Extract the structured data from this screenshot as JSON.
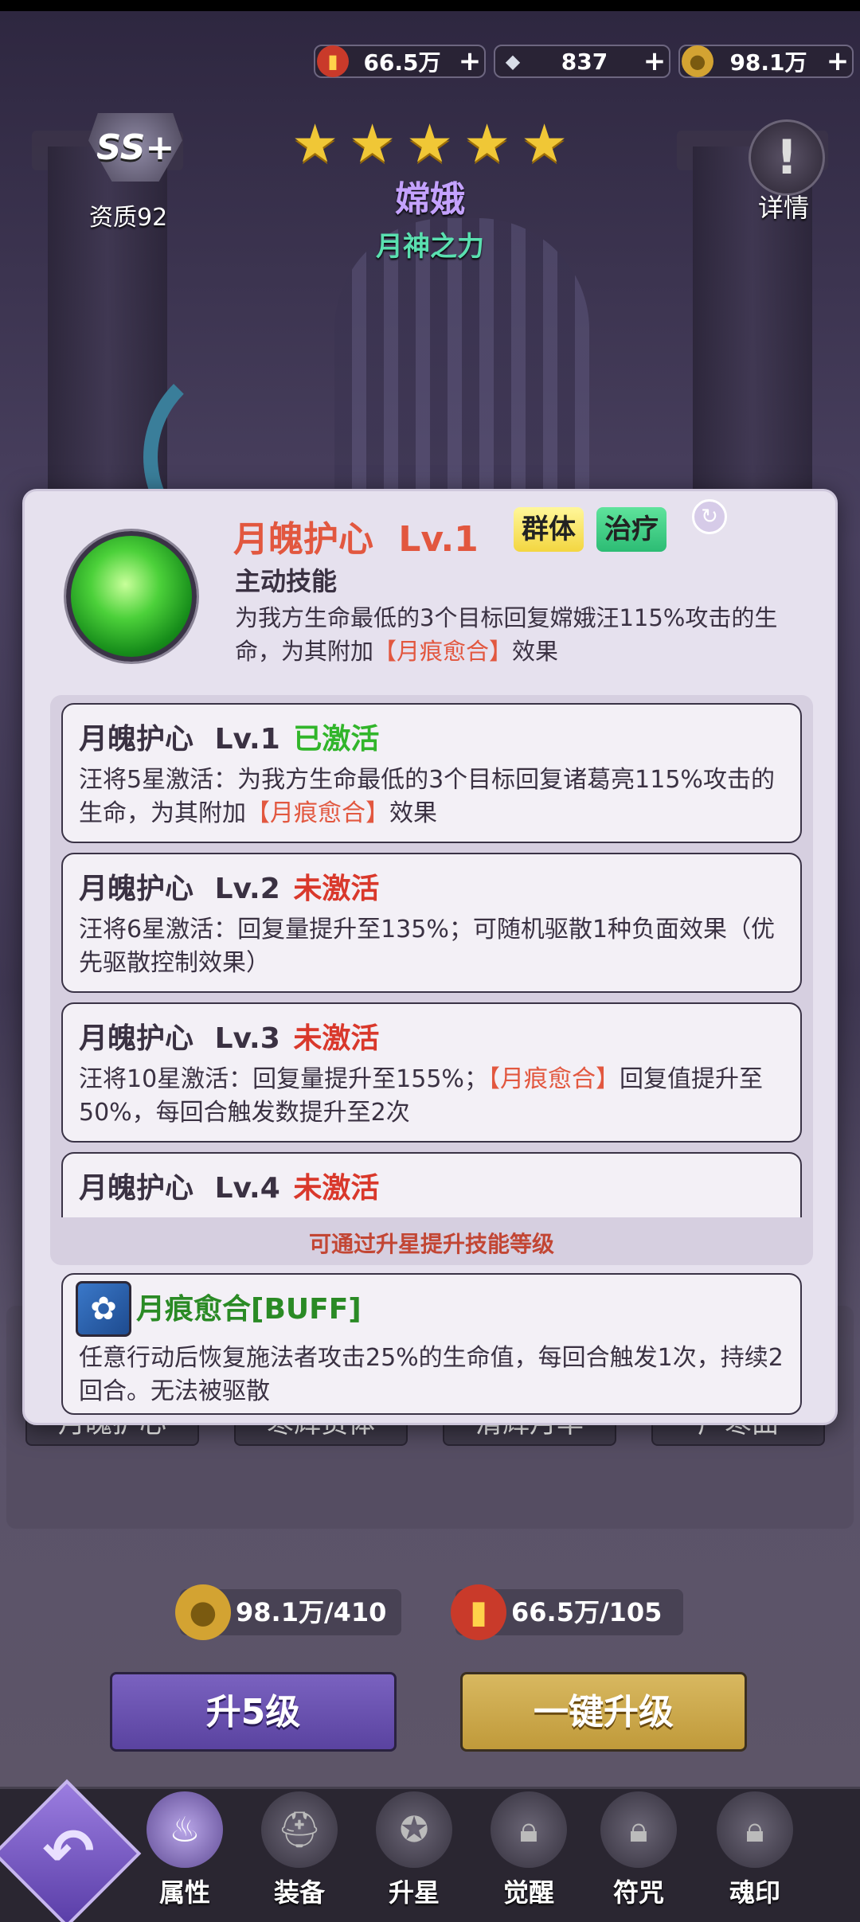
{
  "currency": {
    "fries": {
      "icon": "fries-icon",
      "value": "66.5万"
    },
    "diamond": {
      "icon": "diamond-icon",
      "value": "837"
    },
    "coin": {
      "icon": "coin-icon",
      "value": "98.1万"
    }
  },
  "hero": {
    "rank_badge": "SS+",
    "aptitude": "资质92",
    "stars": 5,
    "name": "嫦娥",
    "title": "月神之力",
    "detail_label": "详情"
  },
  "popup": {
    "skill_name": "月魄护心",
    "skill_level": "Lv.1",
    "tags": [
      "群体",
      "治疗"
    ],
    "skill_type": "主动技能",
    "description_prefix": "为我方生命最低的3个目标回复嫦娥汪115%攻击的生命，为其附加",
    "description_highlight": "【月痕愈合】",
    "description_suffix": "效果",
    "levels": [
      {
        "name": "月魄护心",
        "level": "Lv.1",
        "state": "已激活",
        "active": true,
        "desc_a": "汪将5星激活：为我方生命最低的3个目标回复诸葛亮115%攻击的生命，为其附加",
        "desc_hl": "【月痕愈合】",
        "desc_b": "效果"
      },
      {
        "name": "月魄护心",
        "level": "Lv.2",
        "state": "未激活",
        "active": false,
        "desc_a": "汪将6星激活：回复量提升至135%；可随机驱散1种负面效果（优先驱散控制效果）",
        "desc_hl": "",
        "desc_b": ""
      },
      {
        "name": "月魄护心",
        "level": "Lv.3",
        "state": "未激活",
        "active": false,
        "desc_a": "汪将10星激活：回复量提升至155%；",
        "desc_hl": "【月痕愈合】",
        "desc_b": "回复值提升至50%，每回合触发数提升至2次"
      },
      {
        "name": "月魄护心",
        "level": "Lv.4",
        "state": "未激活",
        "active": false,
        "desc_a": "",
        "desc_hl": "",
        "desc_b": ""
      }
    ],
    "upgrade_hint": "可通过升星提升技能等级",
    "buff": {
      "icon": "clover-icon",
      "title": "月痕愈合[BUFF]",
      "desc": "任意行动后恢复施法者攻击25%的生命值，每回合触发1次，持续2回合。无法被驱散"
    }
  },
  "skills": [
    "月魄护心",
    "寒辉贯体",
    "清辉月华",
    "广寒曲"
  ],
  "costs": {
    "coin": "98.1万/410",
    "fries": "66.5万/105"
  },
  "buttons": {
    "upgrade5": "升5级",
    "one_click": "一键升级"
  },
  "nav": [
    {
      "label": "属性",
      "icon": "flame-icon",
      "locked": false,
      "active": true
    },
    {
      "label": "装备",
      "icon": "helmet-icon",
      "locked": false,
      "active": false
    },
    {
      "label": "升星",
      "icon": "star-ring-icon",
      "locked": false,
      "active": false
    },
    {
      "label": "觉醒",
      "icon": "lock-icon",
      "locked": true,
      "active": false
    },
    {
      "label": "符咒",
      "icon": "lock-icon",
      "locked": true,
      "active": false
    },
    {
      "label": "魂印",
      "icon": "lock-icon",
      "locked": true,
      "active": false
    }
  ],
  "colors": {
    "accent_red": "#e2573f",
    "active_green": "#31b52a",
    "inactive_red": "#d9382b",
    "buff_green": "#2a8a25"
  }
}
